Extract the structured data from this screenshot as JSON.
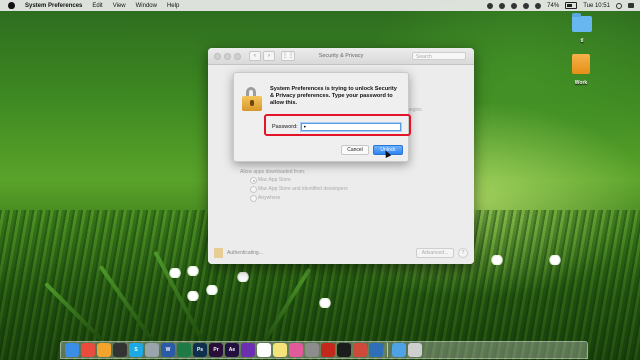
{
  "menubar": {
    "app_name": "System Preferences",
    "menus": [
      "Edit",
      "View",
      "Window",
      "Help"
    ],
    "battery": "74%",
    "clock": "Tue 10:51"
  },
  "desktop": {
    "icons": [
      {
        "label": "tl",
        "icon": "folder-icon"
      },
      {
        "label": "Work",
        "icon": "drive-icon"
      }
    ]
  },
  "window": {
    "title": "Security & Privacy",
    "search_placeholder": "Search",
    "fragment_text": "r begins",
    "allow_heading": "Allow apps downloaded from:",
    "options": [
      {
        "label": "Mac App Store",
        "selected": true
      },
      {
        "label": "Mac App Store and identified developers",
        "selected": false
      },
      {
        "label": "Anywhere",
        "selected": false
      }
    ],
    "auth_status": "Authenticating...",
    "advanced_label": "Advanced...",
    "help_label": "?"
  },
  "dialog": {
    "message": "System Preferences is trying to unlock Security & Privacy preferences. Type your password to allow this.",
    "password_label": "Password:",
    "password_value": "•",
    "cancel_label": "Cancel",
    "unlock_label": "Unlock"
  },
  "dock": {
    "apps": [
      {
        "name": "finder-icon",
        "color": "#3a8ee6",
        "text": ""
      },
      {
        "name": "chrome-icon",
        "color": "#e94b3c",
        "text": ""
      },
      {
        "name": "photos-icon",
        "color": "#f2a42c",
        "text": ""
      },
      {
        "name": "terminal-icon",
        "color": "#333333",
        "text": ""
      },
      {
        "name": "skype-icon",
        "color": "#1ca9e6",
        "text": "S"
      },
      {
        "name": "launchpad-icon",
        "color": "#9aa4ad",
        "text": ""
      },
      {
        "name": "word-icon",
        "color": "#2b5aa7",
        "text": "W"
      },
      {
        "name": "excel-icon",
        "color": "#1f7b45",
        "text": ""
      },
      {
        "name": "photoshop-icon",
        "color": "#0e2f4d",
        "text": "Ps"
      },
      {
        "name": "premiere-icon",
        "color": "#2a0e3a",
        "text": "Pr"
      },
      {
        "name": "aftereffects-icon",
        "color": "#241040",
        "text": "Ae"
      },
      {
        "name": "imovie-icon",
        "color": "#6b2fb0",
        "text": ""
      },
      {
        "name": "calendar-icon",
        "color": "#ffffff",
        "text": ""
      },
      {
        "name": "notes-icon",
        "color": "#f4e27a",
        "text": ""
      },
      {
        "name": "itunes-icon",
        "color": "#e35a9a",
        "text": ""
      },
      {
        "name": "system-preferences-icon",
        "color": "#8d8d8d",
        "text": ""
      },
      {
        "name": "filezilla-icon",
        "color": "#c4281c",
        "text": ""
      },
      {
        "name": "terminal2-icon",
        "color": "#1c1c1c",
        "text": ""
      },
      {
        "name": "misc-icon",
        "color": "#d04a3c",
        "text": ""
      },
      {
        "name": "virtualbox-icon",
        "color": "#2f6fb8",
        "text": ""
      },
      {
        "name": "folder-dock-icon",
        "color": "#4ea3e6",
        "text": ""
      },
      {
        "name": "trash-icon",
        "color": "#cfcfcf",
        "text": ""
      }
    ]
  },
  "colors": {
    "highlight_box": "#e3132a",
    "unlock_button": "#2f83f0"
  }
}
